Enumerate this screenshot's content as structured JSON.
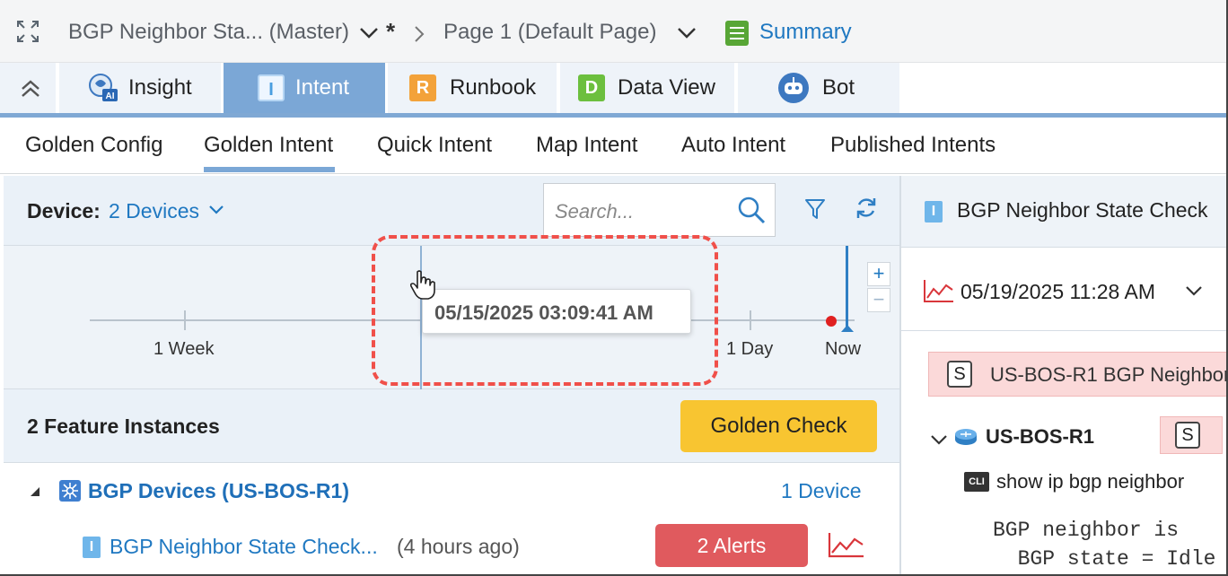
{
  "topbar": {
    "title": "BGP Neighbor Sta... (Master)",
    "modified_mark": "*",
    "page": "Page 1  (Default Page)",
    "summary": "Summary"
  },
  "tabs": [
    {
      "label": "Insight",
      "icon": "insight-ai-icon"
    },
    {
      "label": "Intent",
      "icon": "intent-icon"
    },
    {
      "label": "Runbook",
      "icon": "runbook-icon"
    },
    {
      "label": "Data View",
      "icon": "data-view-icon"
    },
    {
      "label": "Bot",
      "icon": "bot-icon"
    }
  ],
  "subtabs": [
    "Golden Config",
    "Golden Intent",
    "Quick Intent",
    "Map Intent",
    "Auto Intent",
    "Published Intents"
  ],
  "device_bar": {
    "label": "Device:",
    "value": "2 Devices",
    "search_placeholder": "Search..."
  },
  "timeline": {
    "labels": [
      "1 Week",
      "1 Day",
      "Now"
    ],
    "tooltip": "05/15/2025 03:09:41 AM",
    "zoom_in": "+",
    "zoom_out": "−"
  },
  "feature": {
    "title": "2 Feature Instances",
    "golden_check": "Golden Check",
    "group": {
      "name": "BGP Devices (US-BOS-R1)",
      "count": "1 Device"
    },
    "item": {
      "icon_letter": "I",
      "name": "BGP Neighbor State Check...",
      "time": "(4 hours ago)",
      "alerts": "2 Alerts"
    }
  },
  "right_panel": {
    "icon_letter": "I",
    "title": "BGP Neighbor State Check",
    "date": "05/19/2025 11:28 AM",
    "alert": {
      "badge": "S",
      "text": "US-BOS-R1 BGP Neighbor"
    },
    "node": {
      "name": "US-BOS-R1",
      "badge": "S"
    },
    "cli": {
      "badge": "CLI",
      "command": "show ip bgp neighbor"
    },
    "code": [
      "BGP neighbor is",
      "  BGP state = Idle"
    ]
  },
  "colors": {
    "accent_blue": "#1f78c1",
    "tab_active": "#7ba7d6",
    "golden_button": "#f8c531",
    "alert_red": "#e05a5e",
    "highlight_dashed": "#f0504a"
  }
}
